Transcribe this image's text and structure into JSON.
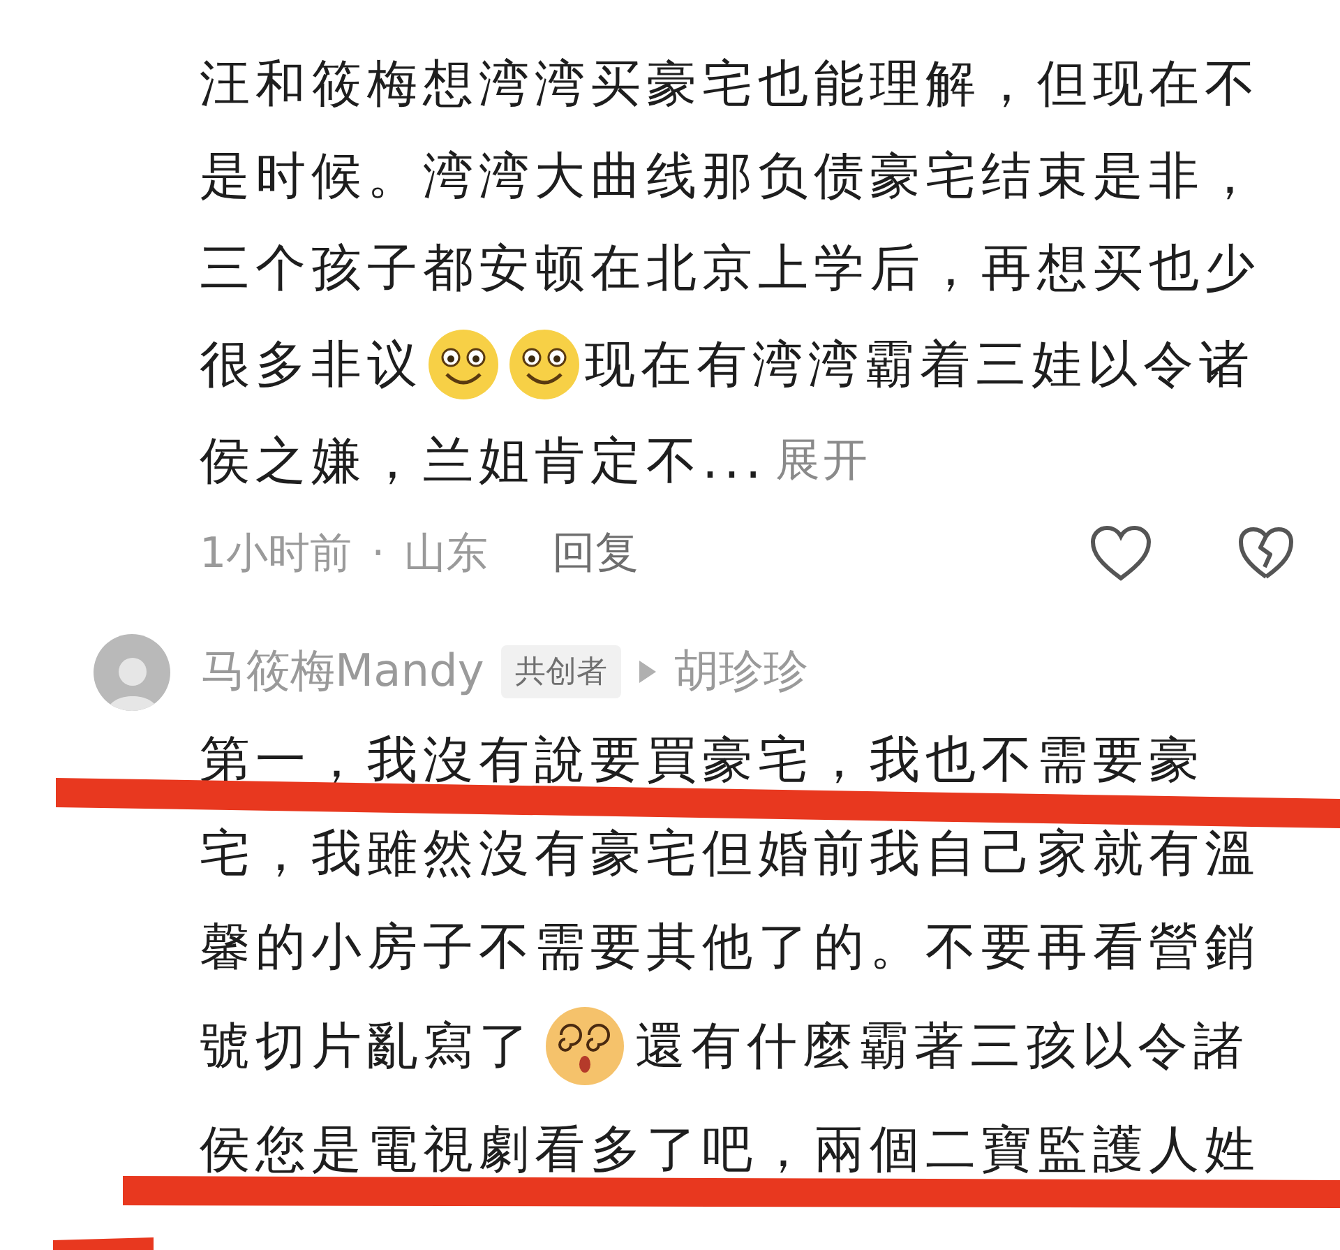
{
  "comments": [
    {
      "lines": [
        [
          {
            "kind": "text",
            "text": "汪和筱梅想湾湾买豪宅也能理解，但现在不"
          }
        ],
        [
          {
            "kind": "text",
            "text": "是时候。湾湾大曲线那负债豪宅结束是非，"
          }
        ],
        [
          {
            "kind": "text",
            "text": "三个孩子都安顿在北京上学后，再想买也少"
          }
        ],
        [
          {
            "kind": "text",
            "text": "很多非议"
          },
          {
            "kind": "smiley"
          },
          {
            "kind": "smiley"
          },
          {
            "kind": "text",
            "text": "现在有湾湾霸着三娃以令诸"
          }
        ],
        [
          {
            "kind": "text",
            "text": "侯之嫌，兰姐肯定不..."
          }
        ]
      ],
      "expand": "展开",
      "time": "1小时前",
      "separator": "·",
      "location": "山东",
      "reply": "回复"
    },
    {
      "author": "马筱梅Mandy",
      "badge": "共创者",
      "reply_to": "胡珍珍",
      "lines": [
        [
          {
            "kind": "text",
            "text": "第一，我沒有說要買豪宅，我也不需要豪"
          }
        ],
        [
          {
            "kind": "text",
            "text": "宅，我雖然沒有豪宅但婚前我自己家就有溫"
          }
        ],
        [
          {
            "kind": "text",
            "text": "馨的小房子不需要其他了的。不要再看營銷"
          }
        ],
        [
          {
            "kind": "text",
            "text": "號切片亂寫了"
          },
          {
            "kind": "dizzy"
          },
          {
            "kind": "text",
            "text": " 還有什麼霸著三孩以令諸"
          }
        ],
        [
          {
            "kind": "text",
            "text": "侯您是電視劇看多了吧，兩個二寶監護人姓"
          }
        ]
      ]
    }
  ]
}
